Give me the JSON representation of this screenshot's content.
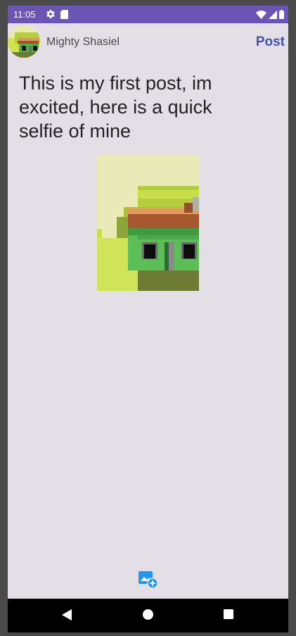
{
  "status_bar": {
    "time": "11:05",
    "icons": [
      "gear-icon",
      "sd-card-icon",
      "wifi-icon",
      "signal-icon",
      "battery-icon"
    ],
    "color": "#6b55b4"
  },
  "header": {
    "username": "Mighty Shasiel",
    "post_label": "Post",
    "post_color": "#3f51b5"
  },
  "post": {
    "text": "This is my first post, im excited, here is a quick selfie of mine"
  },
  "bottom": {
    "add_image_icon": "add-photo-icon"
  },
  "navigation": {
    "buttons": [
      "back-icon",
      "home-icon",
      "recents-icon"
    ]
  }
}
